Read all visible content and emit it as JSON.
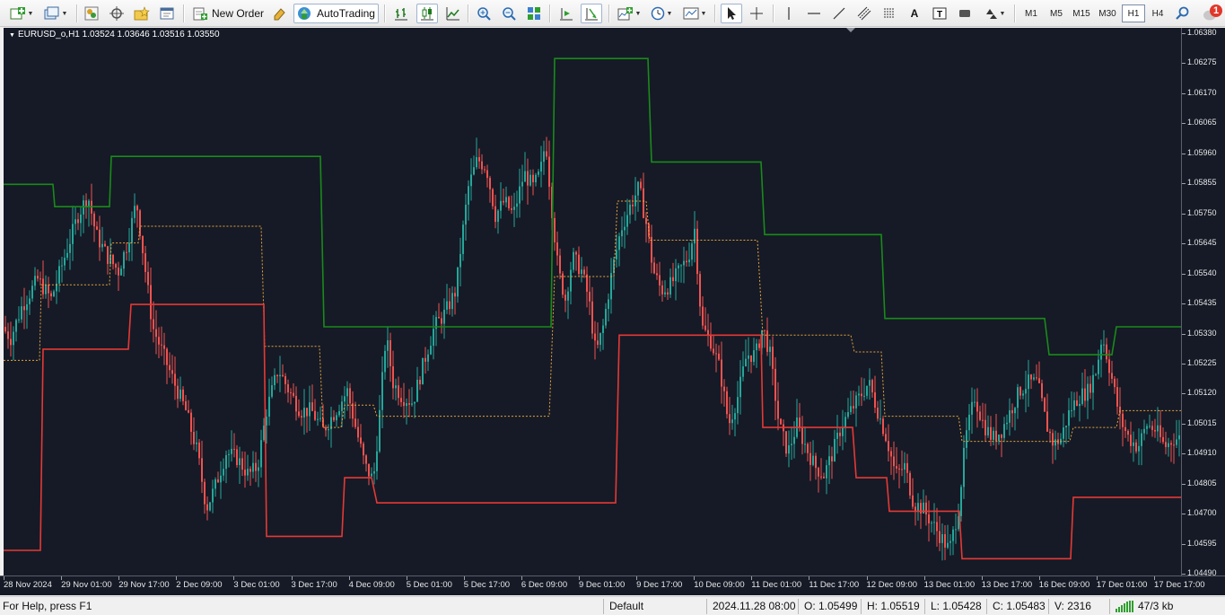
{
  "toolbar": {
    "new_order_label": "New Order",
    "autotrading_label": "AutoTrading",
    "timeframes": [
      "M1",
      "M5",
      "M15",
      "M30",
      "H1",
      "H4"
    ],
    "active_timeframe": "H1",
    "notification_count": "1"
  },
  "chart": {
    "title": "EURUSD_o,H1  1.03524 1.03646 1.03516 1.03550",
    "background": "#151a26",
    "bull_color": "#26a69a",
    "bear_color": "#ef5350",
    "upper_channel_color": "#1a8a1a",
    "lower_channel_color": "#e53935",
    "mid_channel_color": "#e8a23a"
  },
  "price_axis": {
    "labels": [
      "1.06380",
      "1.06275",
      "1.06170",
      "1.06065",
      "1.05960",
      "1.05855",
      "1.05750",
      "1.05645",
      "1.05540",
      "1.05435",
      "1.05330",
      "1.05225",
      "1.05120",
      "1.05015",
      "1.04910",
      "1.04805",
      "1.04700",
      "1.04595",
      "1.04490"
    ]
  },
  "time_axis": {
    "labels": [
      "28 Nov 2024",
      "29 Nov 01:00",
      "29 Nov 17:00",
      "2 Dec 09:00",
      "3 Dec 01:00",
      "3 Dec 17:00",
      "4 Dec 09:00",
      "5 Dec 01:00",
      "5 Dec 17:00",
      "6 Dec 09:00",
      "9 Dec 01:00",
      "9 Dec 17:00",
      "10 Dec 09:00",
      "11 Dec 01:00",
      "11 Dec 17:00",
      "12 Dec 09:00",
      "13 Dec 01:00",
      "13 Dec 17:00",
      "16 Dec 09:00",
      "17 Dec 01:00",
      "17 Dec 17:00"
    ]
  },
  "chart_data": {
    "type": "candlestick",
    "symbol": "EURUSD_o",
    "timeframe": "H1",
    "last_ohlc": {
      "open": 1.03524,
      "high": 1.03646,
      "low": 1.03516,
      "close": 1.0355
    },
    "ylim": [
      1.0446,
      1.0642
    ],
    "price_path": [
      [
        0,
        1.0535
      ],
      [
        10,
        1.0531
      ],
      [
        22,
        1.0542
      ],
      [
        40,
        1.0552
      ],
      [
        55,
        1.0545
      ],
      [
        72,
        1.0562
      ],
      [
        85,
        1.0575
      ],
      [
        96,
        1.0582
      ],
      [
        105,
        1.0568
      ],
      [
        118,
        1.056
      ],
      [
        130,
        1.0555
      ],
      [
        140,
        1.0565
      ],
      [
        150,
        1.058
      ],
      [
        160,
        1.0555
      ],
      [
        168,
        1.0535
      ],
      [
        180,
        1.0525
      ],
      [
        192,
        1.0515
      ],
      [
        205,
        1.0505
      ],
      [
        218,
        1.049
      ],
      [
        228,
        1.047
      ],
      [
        238,
        1.0478
      ],
      [
        250,
        1.049
      ],
      [
        262,
        1.0488
      ],
      [
        275,
        1.0482
      ],
      [
        285,
        1.0485
      ],
      [
        295,
        1.0505
      ],
      [
        308,
        1.052
      ],
      [
        320,
        1.0512
      ],
      [
        333,
        1.0505
      ],
      [
        345,
        1.0505
      ],
      [
        358,
        1.0498
      ],
      [
        372,
        1.0505
      ],
      [
        385,
        1.0512
      ],
      [
        395,
        1.0498
      ],
      [
        405,
        1.0485
      ],
      [
        414,
        1.048
      ],
      [
        420,
        1.05
      ],
      [
        428,
        1.0532
      ],
      [
        436,
        1.0515
      ],
      [
        446,
        1.051
      ],
      [
        458,
        1.0508
      ],
      [
        470,
        1.0522
      ],
      [
        482,
        1.0535
      ],
      [
        494,
        1.054
      ],
      [
        506,
        1.0548
      ],
      [
        512,
        1.0565
      ],
      [
        520,
        1.0585
      ],
      [
        530,
        1.0595
      ],
      [
        540,
        1.0592
      ],
      [
        550,
        1.0575
      ],
      [
        560,
        1.058
      ],
      [
        570,
        1.0575
      ],
      [
        582,
        1.059
      ],
      [
        592,
        1.0585
      ],
      [
        600,
        1.059
      ],
      [
        606,
        1.0602
      ],
      [
        612,
        1.058
      ],
      [
        620,
        1.0555
      ],
      [
        628,
        1.0545
      ],
      [
        636,
        1.056
      ],
      [
        646,
        1.0555
      ],
      [
        654,
        1.0545
      ],
      [
        662,
        1.0525
      ],
      [
        670,
        1.0535
      ],
      [
        680,
        1.0555
      ],
      [
        690,
        1.057
      ],
      [
        700,
        1.0578
      ],
      [
        710,
        1.0585
      ],
      [
        718,
        1.0572
      ],
      [
        726,
        1.0555
      ],
      [
        735,
        1.0548
      ],
      [
        745,
        1.055
      ],
      [
        755,
        1.0555
      ],
      [
        765,
        1.056
      ],
      [
        772,
        1.057
      ],
      [
        780,
        1.0535
      ],
      [
        790,
        1.053
      ],
      [
        800,
        1.052
      ],
      [
        810,
        1.05
      ],
      [
        820,
        1.051
      ],
      [
        830,
        1.0525
      ],
      [
        840,
        1.0525
      ],
      [
        848,
        1.0535
      ],
      [
        856,
        1.0525
      ],
      [
        866,
        1.05
      ],
      [
        876,
        1.049
      ],
      [
        886,
        1.05
      ],
      [
        896,
        1.0492
      ],
      [
        906,
        1.0485
      ],
      [
        916,
        1.0482
      ],
      [
        926,
        1.049
      ],
      [
        936,
        1.05
      ],
      [
        946,
        1.0505
      ],
      [
        956,
        1.051
      ],
      [
        966,
        1.0515
      ],
      [
        976,
        1.0505
      ],
      [
        986,
        1.0495
      ],
      [
        996,
        1.0482
      ],
      [
        1006,
        1.0485
      ],
      [
        1016,
        1.0472
      ],
      [
        1026,
        1.047
      ],
      [
        1036,
        1.0465
      ],
      [
        1046,
        1.046
      ],
      [
        1056,
        1.0455
      ],
      [
        1066,
        1.047
      ],
      [
        1074,
        1.0495
      ],
      [
        1084,
        1.051
      ],
      [
        1094,
        1.05
      ],
      [
        1104,
        1.0495
      ],
      [
        1114,
        1.0498
      ],
      [
        1124,
        1.0505
      ],
      [
        1134,
        1.0512
      ],
      [
        1144,
        1.0515
      ],
      [
        1154,
        1.0515
      ],
      [
        1164,
        1.05
      ],
      [
        1172,
        1.0493
      ],
      [
        1180,
        1.0495
      ],
      [
        1190,
        1.0505
      ],
      [
        1200,
        1.051
      ],
      [
        1210,
        1.0512
      ],
      [
        1220,
        1.052
      ],
      [
        1226,
        1.0532
      ],
      [
        1236,
        1.0518
      ],
      [
        1246,
        1.0502
      ],
      [
        1256,
        1.0495
      ],
      [
        1266,
        1.0492
      ],
      [
        1276,
        1.05
      ],
      [
        1286,
        1.0498
      ],
      [
        1296,
        1.0492
      ],
      [
        1306,
        1.0495
      ],
      [
        1312,
        1.0495
      ]
    ],
    "upper_channel": [
      [
        0,
        1.0586
      ],
      [
        55,
        1.0586
      ],
      [
        57,
        1.0578
      ],
      [
        118,
        1.0578
      ],
      [
        120,
        1.0596
      ],
      [
        353,
        1.0596
      ],
      [
        357,
        1.0535
      ],
      [
        610,
        1.0535
      ],
      [
        614,
        1.0631
      ],
      [
        718,
        1.0631
      ],
      [
        722,
        1.0594
      ],
      [
        844,
        1.0594
      ],
      [
        848,
        1.0568
      ],
      [
        978,
        1.0568
      ],
      [
        982,
        1.0538
      ],
      [
        1160,
        1.0538
      ],
      [
        1165,
        1.0525
      ],
      [
        1235,
        1.0525
      ],
      [
        1240,
        1.0535
      ],
      [
        1312,
        1.0535
      ]
    ],
    "lower_channel": [
      [
        0,
        1.0455
      ],
      [
        41,
        1.0455
      ],
      [
        44,
        1.0527
      ],
      [
        139,
        1.0527
      ],
      [
        142,
        1.0543
      ],
      [
        290,
        1.0543
      ],
      [
        293,
        1.046
      ],
      [
        377,
        1.046
      ],
      [
        380,
        1.0481
      ],
      [
        410,
        1.0481
      ],
      [
        416,
        1.0472
      ],
      [
        682,
        1.0472
      ],
      [
        686,
        1.0532
      ],
      [
        844,
        1.0532
      ],
      [
        846,
        1.0499
      ],
      [
        946,
        1.0499
      ],
      [
        950,
        1.0481
      ],
      [
        984,
        1.0481
      ],
      [
        987,
        1.0469
      ],
      [
        1065,
        1.0469
      ],
      [
        1068,
        1.0452
      ],
      [
        1189,
        1.0452
      ],
      [
        1192,
        1.0474
      ],
      [
        1312,
        1.0474
      ]
    ],
    "mid_channel": [
      [
        0,
        1.0523
      ],
      [
        40,
        1.0523
      ],
      [
        42,
        1.055
      ],
      [
        118,
        1.055
      ],
      [
        120,
        1.0565
      ],
      [
        150,
        1.0565
      ],
      [
        152,
        1.0571
      ],
      [
        287,
        1.0571
      ],
      [
        291,
        1.0528
      ],
      [
        352,
        1.0528
      ],
      [
        356,
        1.0499
      ],
      [
        376,
        1.0499
      ],
      [
        380,
        1.0507
      ],
      [
        412,
        1.0507
      ],
      [
        416,
        1.0503
      ],
      [
        608,
        1.0503
      ],
      [
        614,
        1.0553
      ],
      [
        680,
        1.0553
      ],
      [
        684,
        1.058
      ],
      [
        716,
        1.058
      ],
      [
        720,
        1.0566
      ],
      [
        840,
        1.0566
      ],
      [
        846,
        1.0532
      ],
      [
        944,
        1.0532
      ],
      [
        948,
        1.0526
      ],
      [
        978,
        1.0526
      ],
      [
        982,
        1.0503
      ],
      [
        1064,
        1.0503
      ],
      [
        1068,
        1.0494
      ],
      [
        1188,
        1.0494
      ],
      [
        1192,
        1.0499
      ],
      [
        1240,
        1.0499
      ],
      [
        1244,
        1.0505
      ],
      [
        1312,
        1.0505
      ]
    ]
  },
  "status": {
    "help": "For Help, press F1",
    "profile": "Default",
    "datetime": "2024.11.28 08:00",
    "open": "O: 1.05499",
    "high": "H: 1.05519",
    "low": "L: 1.05428",
    "close": "C: 1.05483",
    "volume": "V: 2316",
    "traffic": "47/3 kb"
  }
}
